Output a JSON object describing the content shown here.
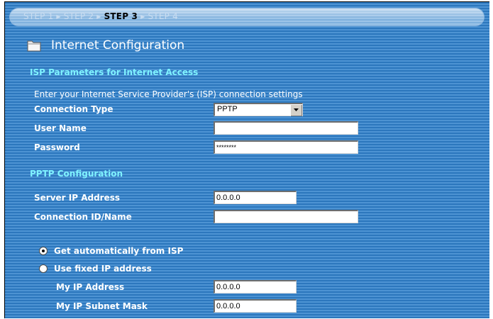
{
  "steps": {
    "step1": "STEP 1",
    "step2": "STEP 2",
    "step3": "STEP 3",
    "step4": "STEP 4",
    "current": "STEP 3"
  },
  "page": {
    "title": "Internet Configuration",
    "title_icon": "folder-icon"
  },
  "isp": {
    "heading": "ISP Parameters for Internet Access",
    "description": "Enter your Internet Service Provider's (ISP) connection settings",
    "connection_type_label": "Connection Type",
    "connection_type_value": "PPTP",
    "user_name_label": "User Name",
    "user_name_value": "",
    "password_label": "Password",
    "password_value": "********"
  },
  "pptp": {
    "heading": "PPTP Configuration",
    "server_ip_label": "Server IP Address",
    "server_ip_value": "0.0.0.0",
    "connection_id_label": "Connection ID/Name",
    "connection_id_value": "",
    "auto_ip_label": "Get automatically from ISP",
    "auto_ip_selected": true,
    "fixed_ip_label": "Use fixed IP address",
    "fixed_ip_selected": false,
    "my_ip_label": "My IP Address",
    "my_ip_value": "0.0.0.0",
    "subnet_label": "My IP Subnet Mask",
    "subnet_value": "0.0.0.0"
  },
  "colors": {
    "section_heading": "#7ff3ff",
    "panel_stripe_dark": "#2c77bd",
    "panel_stripe_light": "#4d93d3",
    "current_step": "#000000",
    "inactive_step": "#c8dcf0"
  }
}
